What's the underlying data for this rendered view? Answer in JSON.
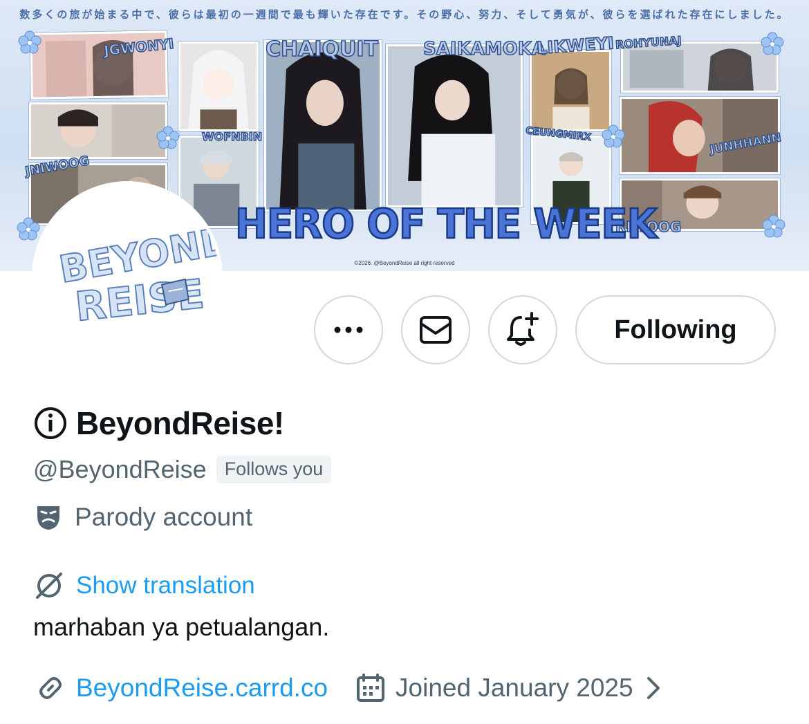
{
  "banner": {
    "top_text": "数多くの旅が始まる中で、彼らは最初の一週間で最も輝いた存在です。その野心、努力、そして勇気が、彼らを選ばれた存在にしました。",
    "names": [
      "JGWONYI",
      "WOFNBIN",
      "JNIWOOG",
      "CHAIQUIT",
      "SAIKAMOKA",
      "LIKWEYI",
      "ROHYUNAJ",
      "CEUNGMIRX",
      "JUNHHANN",
      "RIWOOG"
    ],
    "headline": "HERO OF THE WEEK",
    "copyright": "©2026. @BeyondReise all right reserved"
  },
  "avatar": {
    "line1": "BEYOND",
    "line2": "REISE"
  },
  "actions": {
    "more_icon": "more-dots-icon",
    "message_icon": "envelope-icon",
    "notify_icon": "bell-plus-icon",
    "following_label": "Following"
  },
  "profile": {
    "name_icon": "info-circle-icon",
    "display_name": "BeyondReise!",
    "handle": "@BeyondReise",
    "follows_you": "Follows you",
    "parody_label": "Parody account",
    "translation_label": "Show translation",
    "bio": "marhaban ya petualangan.",
    "website": "BeyondReise.carrd.co",
    "joined": "Joined January 2025"
  },
  "colors": {
    "link": "#1d9bf0",
    "secondary_text": "#536471",
    "primary_text": "#0f1419",
    "border": "#cfd9de"
  }
}
